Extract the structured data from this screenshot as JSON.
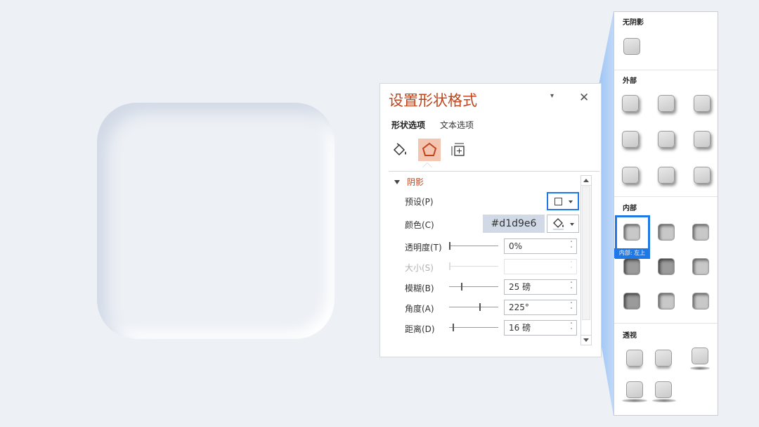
{
  "canvas": {
    "card_name": "neumorphic-card"
  },
  "pane": {
    "title": "设置形状格式",
    "menu_glyph": "▾",
    "close_glyph": "✕",
    "tabs": [
      "形状选项",
      "文本选项"
    ],
    "icons": [
      "fill-line-icon",
      "effects-icon",
      "size-properties-icon"
    ],
    "section": {
      "title": "阴影",
      "preset_label": "预设(P)",
      "color_label": "颜色(C)",
      "color_hex": "#d1d9e6",
      "rows": [
        {
          "label": "透明度(T)",
          "value": "0%",
          "slider": 0.0,
          "disabled": false
        },
        {
          "label": "大小(S)",
          "value": "",
          "slider": 0.0,
          "disabled": true
        },
        {
          "label": "模糊(B)",
          "value": "25 磅",
          "slider": 0.25,
          "disabled": false
        },
        {
          "label": "角度(A)",
          "value": "225°",
          "slider": 0.625,
          "disabled": false
        },
        {
          "label": "距离(D)",
          "value": "16 磅",
          "slider": 0.08,
          "disabled": false
        }
      ]
    }
  },
  "gallery": {
    "sections": {
      "none": "无阴影",
      "outer": "外部",
      "inner": "内部",
      "perspective": "透视"
    },
    "tooltip": "内部: 左上"
  },
  "colors": {
    "background": "#edf0f5",
    "shadow_dark": "#d1d9e6",
    "accent_title": "#c0451c",
    "highlight_blue": "#1e78e6"
  }
}
